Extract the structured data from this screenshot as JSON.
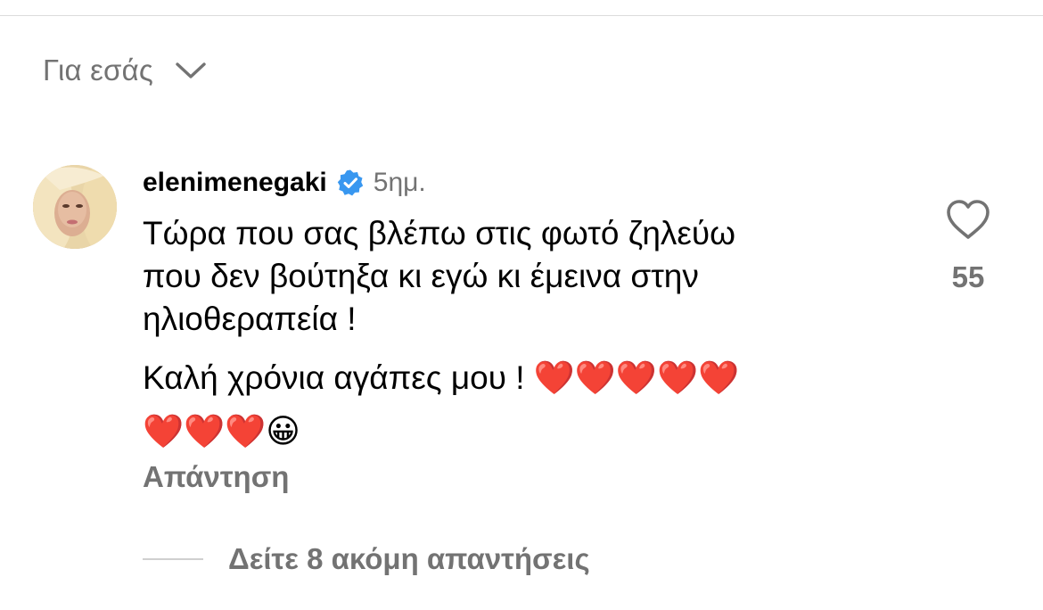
{
  "filter": {
    "label": "Για εσάς",
    "icon": "chevron-down-icon"
  },
  "comment": {
    "username": "elenimenegaki",
    "verified_icon": "verified-badge-icon",
    "time": "5ημ.",
    "paragraph1": "Τώρα που σας βλέπω στις φωτό ζηλεύω\nπου δεν βούτηξα κι εγώ κι έμεινα στην\nηλιοθεραπεία !",
    "paragraph2": "Καλή χρόνια αγάπες μου ! ❤️❤️❤️❤️❤️\n❤️❤️❤️😀",
    "reply_label": "Απάντηση",
    "like_icon": "heart-outline-icon",
    "like_count": "55"
  },
  "more_replies": {
    "label": "Δείτε 8 ακόμη απαντήσεις"
  },
  "colors": {
    "secondary_text": "#737373",
    "verified_blue": "#3897f0",
    "divider": "#dbdbdb"
  }
}
